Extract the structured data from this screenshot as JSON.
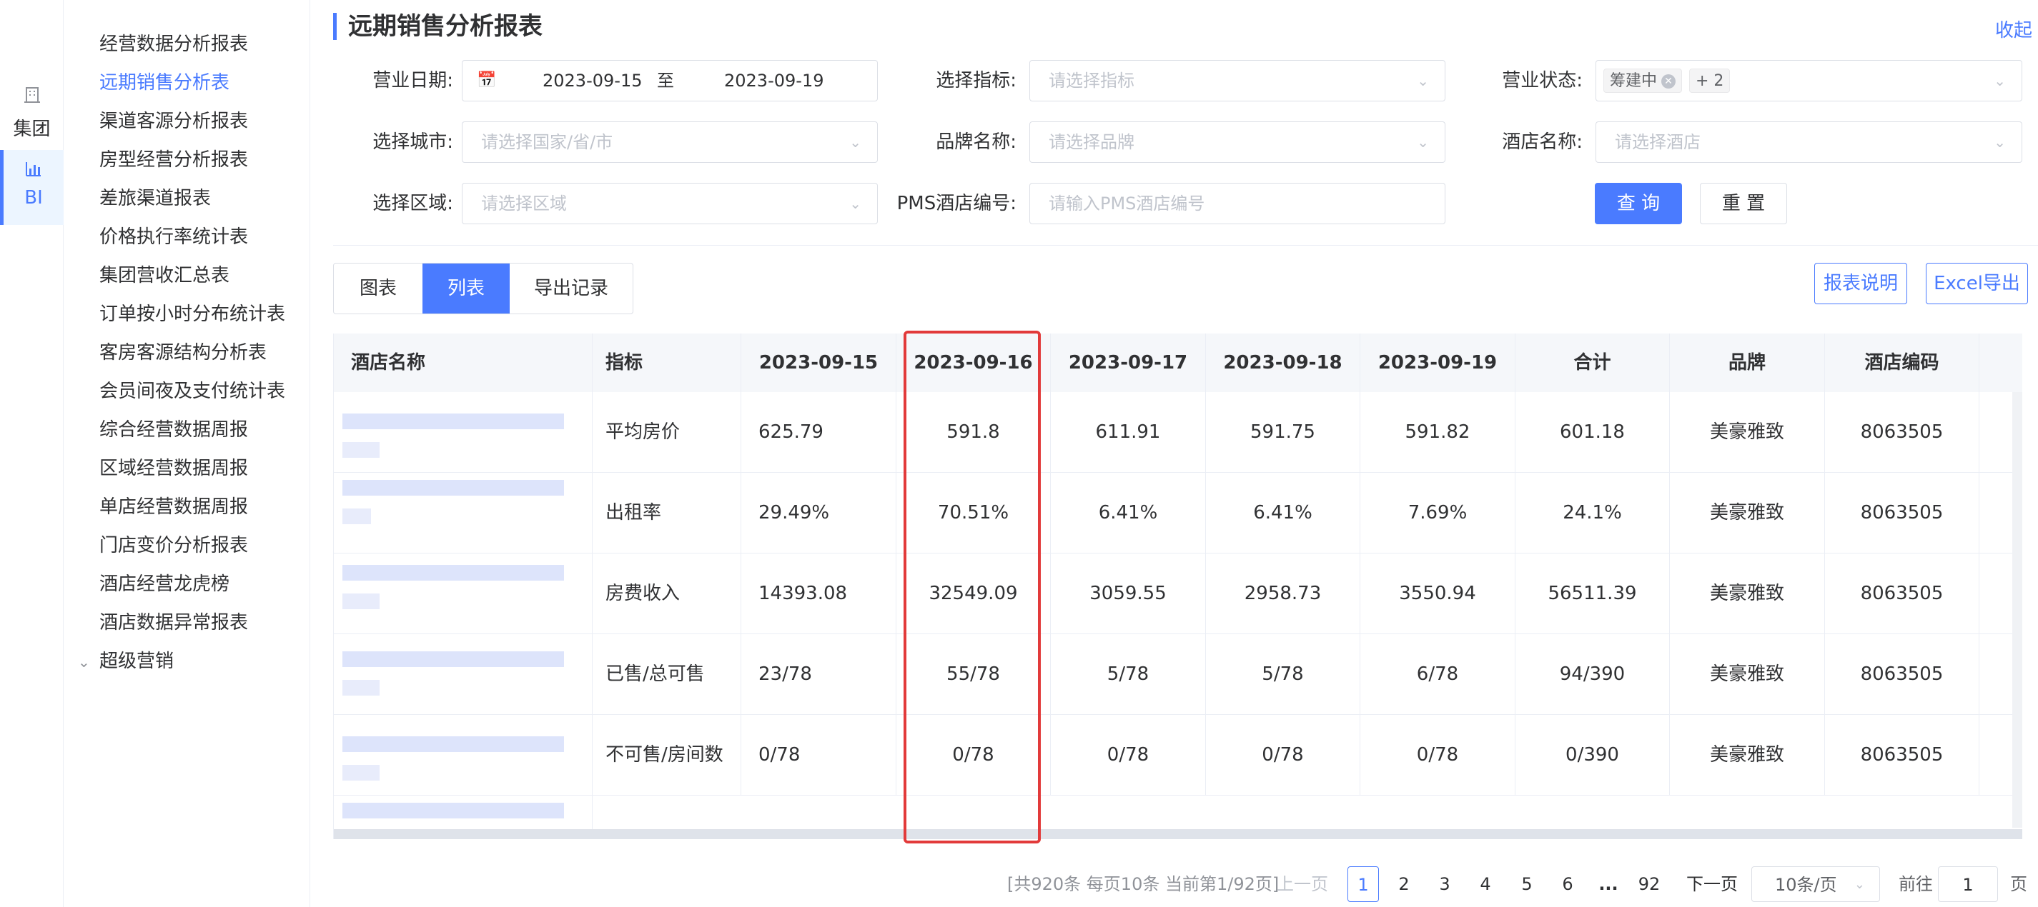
{
  "rail": {
    "group_label": "集团",
    "bi_label": "BI"
  },
  "submenu": {
    "items": [
      {
        "label": "经营数据分析报表"
      },
      {
        "label": "远期销售分析表"
      },
      {
        "label": "渠道客源分析报表"
      },
      {
        "label": "房型经营分析报表"
      },
      {
        "label": "差旅渠道报表"
      },
      {
        "label": "价格执行率统计表"
      },
      {
        "label": "集团营收汇总表"
      },
      {
        "label": "订单按小时分布统计表"
      },
      {
        "label": "客房客源结构分析表"
      },
      {
        "label": "会员间夜及支付统计表"
      },
      {
        "label": "综合经营数据周报"
      },
      {
        "label": "区域经营数据周报"
      },
      {
        "label": "单店经营数据周报"
      },
      {
        "label": "门店变价分析报表"
      },
      {
        "label": "酒店经营龙虎榜"
      },
      {
        "label": "酒店数据异常报表"
      }
    ],
    "active_index": 1,
    "group": {
      "label": "超级营销"
    }
  },
  "header": {
    "title": "远期销售分析报表",
    "collapse_label": "收起"
  },
  "filters": {
    "business_date": {
      "label": "营业日期:",
      "start": "2023-09-15",
      "separator": "至",
      "end": "2023-09-19"
    },
    "indicator": {
      "label": "选择指标:",
      "placeholder": "请选择指标"
    },
    "status": {
      "label": "营业状态:",
      "tag": "筹建中",
      "more": "+ 2"
    },
    "city": {
      "label": "选择城市:",
      "placeholder": "请选择国家/省/市"
    },
    "brand": {
      "label": "品牌名称:",
      "placeholder": "请选择品牌"
    },
    "hotel": {
      "label": "酒店名称:",
      "placeholder": "请选择酒店"
    },
    "region": {
      "label": "选择区域:",
      "placeholder": "请选择区域"
    },
    "pms": {
      "label": "PMS酒店编号:",
      "placeholder": "请输入PMS酒店编号"
    },
    "query_label": "查 询",
    "reset_label": "重 置"
  },
  "tabs": [
    {
      "label": "图表"
    },
    {
      "label": "列表"
    },
    {
      "label": "导出记录"
    }
  ],
  "actions": {
    "report_desc": "报表说明",
    "excel_export": "Excel导出"
  },
  "table": {
    "headers": [
      "酒店名称",
      "指标",
      "2023-09-15",
      "2023-09-16",
      "2023-09-17",
      "2023-09-18",
      "2023-09-19",
      "合计",
      "品牌",
      "酒店编码"
    ],
    "rows": [
      [
        "",
        "平均房价",
        "625.79",
        "591.8",
        "611.91",
        "591.75",
        "591.82",
        "601.18",
        "美豪雅致",
        "8063505"
      ],
      [
        "",
        "出租率",
        "29.49%",
        "70.51%",
        "6.41%",
        "6.41%",
        "7.69%",
        "24.1%",
        "美豪雅致",
        "8063505"
      ],
      [
        "",
        "房费收入",
        "14393.08",
        "32549.09",
        "3059.55",
        "2958.73",
        "3550.94",
        "56511.39",
        "美豪雅致",
        "8063505"
      ],
      [
        "",
        "已售/总可售",
        "23/78",
        "55/78",
        "5/78",
        "5/78",
        "6/78",
        "94/390",
        "美豪雅致",
        "8063505"
      ],
      [
        "",
        "不可售/房间数",
        "0/78",
        "0/78",
        "0/78",
        "0/78",
        "0/78",
        "0/390",
        "美豪雅致",
        "8063505"
      ]
    ]
  },
  "pagination": {
    "summary": "[共920条 每页10条 当前第1/92页]",
    "prev": "上一页",
    "pages": [
      "1",
      "2",
      "3",
      "4",
      "5",
      "6"
    ],
    "ellipsis": "...",
    "last": "92",
    "next": "下一页",
    "page_size": "10条/页",
    "goto_label": "前往",
    "goto_value": "1",
    "page_suffix": "页"
  },
  "colors": {
    "primary": "#4a7bff",
    "highlight": "#e23a3a"
  }
}
